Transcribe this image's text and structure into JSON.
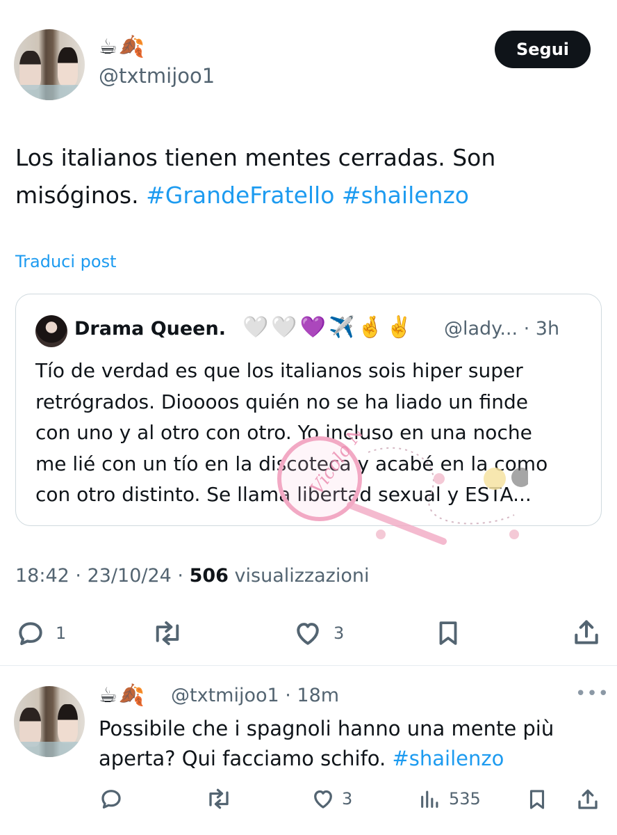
{
  "tweet": {
    "emojis": "☕🍂",
    "handle": "@txtmijoo1",
    "follow_label": "Segui",
    "text_plain": "Los italianos tienen mentes cerradas. Son misóginos. ",
    "hashtag_1": "#GrandeFratello",
    "hashtag_2": "#shailenzo",
    "translate_label": "Traduci post",
    "time": "18:42",
    "date": "23/10/24",
    "views_count": "506",
    "views_label": "visualizzazioni",
    "replies": "1",
    "likes": "3"
  },
  "quote": {
    "name": "Drama Queen.",
    "name_emojis": "🤍🤍💜✈️🤞✌️",
    "meta": "@lady... · 3h",
    "text": "Tío de verdad es que los italianos sois hiper super\nretrógrados. Dioooos quién no se ha liado un finde\ncon uno y al otro con otro. Yo incluso en una noche\nme lié con un tío en la discoteca y acabé en la como\ncon otro distinto. Se llama libertad sexual y ESTA..."
  },
  "watermark": {
    "text": "Vicolo News"
  },
  "reply": {
    "emojis": "☕🍂",
    "handle_meta": "@txtmijoo1 · 18m",
    "more": "•••",
    "text_plain": "Possibile che i spagnoli hanno una mente più aperta? Qui facciamo schifo. ",
    "hashtag": "#shailenzo",
    "likes": "3",
    "views": "535"
  },
  "colors": {
    "accent": "#1d9bf0",
    "secondary_text": "#536471",
    "primary_text": "#0f1419",
    "border": "#cfd9de"
  },
  "icons": [
    "reply-icon",
    "retweet-icon",
    "heart-icon",
    "bookmark-icon",
    "share-icon",
    "views-icon"
  ]
}
